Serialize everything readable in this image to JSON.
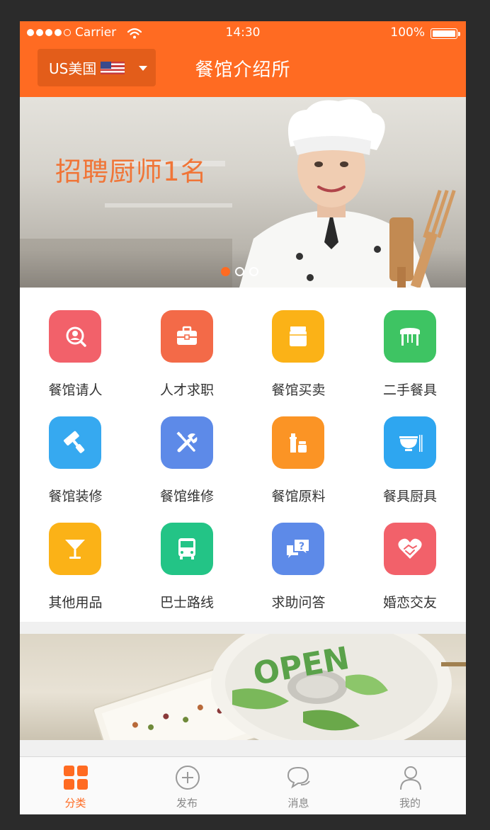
{
  "status_bar": {
    "carrier": "Carrier",
    "time": "14:30",
    "battery": "100%",
    "battery_level": 1.0,
    "signal_bars_filled": 4,
    "signal_bars_total": 5
  },
  "header": {
    "region_label": "US美国",
    "title": "餐馆介绍所",
    "background_color": "#ff6b22"
  },
  "banner": {
    "text": "招聘厨师1名",
    "slide_count": 3,
    "active_slide": 1
  },
  "categories": [
    {
      "label": "餐馆请人",
      "icon": "search-person-icon",
      "color": "#f2616a"
    },
    {
      "label": "人才求职",
      "icon": "briefcase-icon",
      "color": "#f36a48"
    },
    {
      "label": "餐馆买卖",
      "icon": "jar-icon",
      "color": "#fbb217"
    },
    {
      "label": "二手餐具",
      "icon": "table-icon",
      "color": "#3ec463"
    },
    {
      "label": "餐馆装修",
      "icon": "paint-roller-icon",
      "color": "#36a9f0"
    },
    {
      "label": "餐馆维修",
      "icon": "tools-icon",
      "color": "#5d8ae8"
    },
    {
      "label": "餐馆原料",
      "icon": "bottles-icon",
      "color": "#fb9425"
    },
    {
      "label": "餐具厨具",
      "icon": "bowl-icon",
      "color": "#2ea6f0"
    },
    {
      "label": "其他用品",
      "icon": "cocktail-glass-icon",
      "color": "#fbb217"
    },
    {
      "label": "巴士路线",
      "icon": "bus-icon",
      "color": "#23c486"
    },
    {
      "label": "求助问答",
      "icon": "question-chat-icon",
      "color": "#5d8ae8"
    },
    {
      "label": "婚恋交友",
      "icon": "heart-handshake-icon",
      "color": "#f2616a"
    }
  ],
  "tabbar": {
    "tabs": [
      {
        "label": "分类",
        "icon": "grid-icon",
        "active": true
      },
      {
        "label": "发布",
        "icon": "plus-circle-icon",
        "active": false
      },
      {
        "label": "消息",
        "icon": "chat-bubbles-icon",
        "active": false
      },
      {
        "label": "我的",
        "icon": "user-icon",
        "active": false
      }
    ]
  }
}
